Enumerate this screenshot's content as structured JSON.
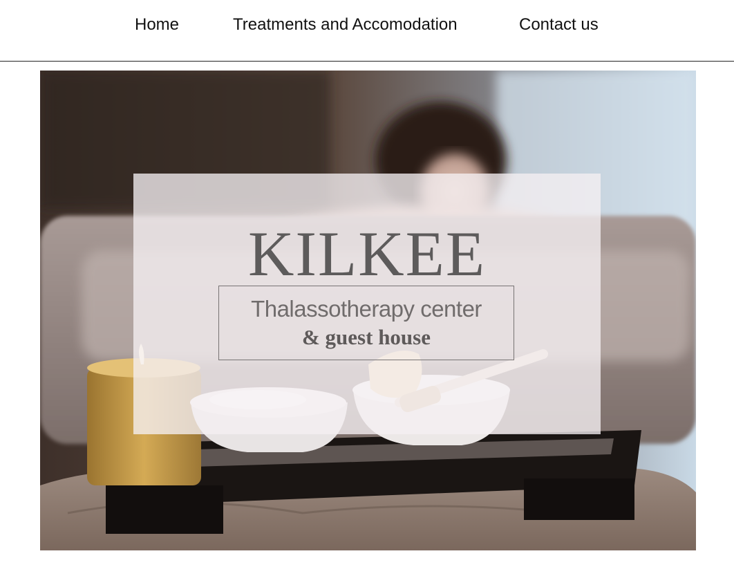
{
  "nav": {
    "items": [
      {
        "label": "Home"
      },
      {
        "label": "Treatments and Accomodation"
      },
      {
        "label": "Contact us"
      }
    ]
  },
  "hero": {
    "logo": {
      "title": "KILKEE",
      "subtitle_line1": "Thalassotherapy center",
      "subtitle_line2": "& guest house"
    }
  }
}
